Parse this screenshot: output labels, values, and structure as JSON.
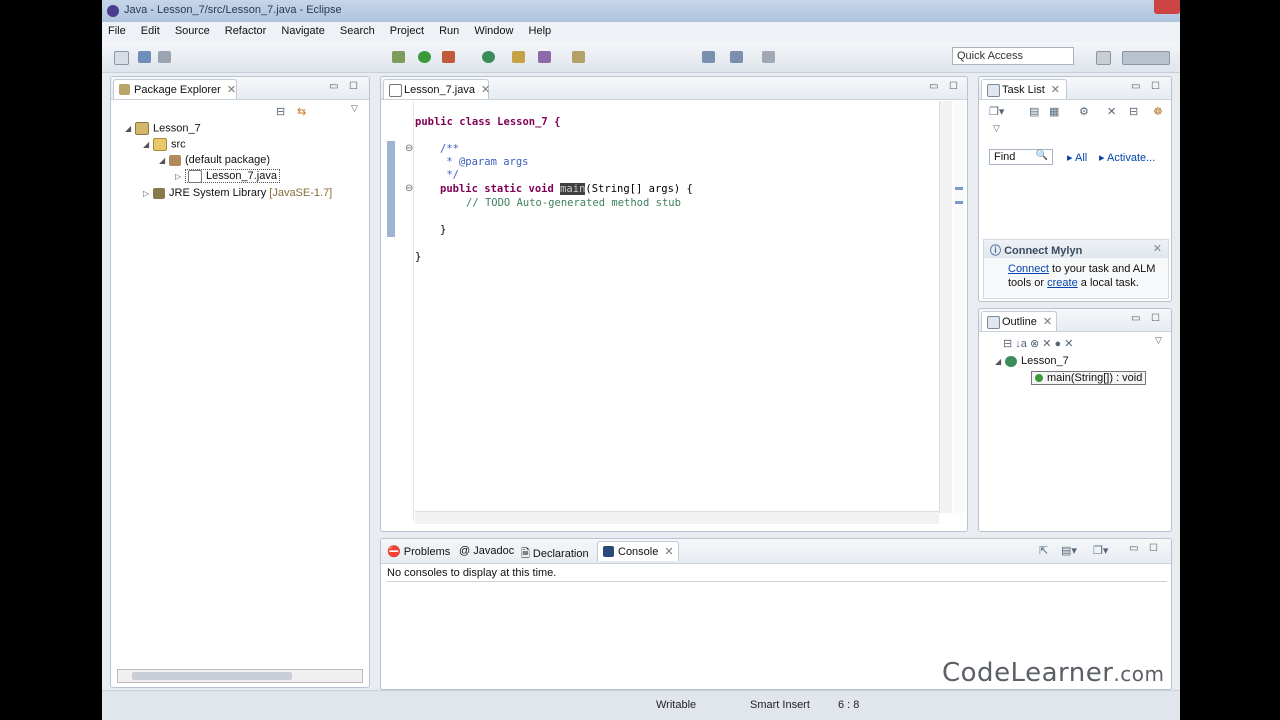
{
  "window": {
    "title": "Java - Lesson_7/src/Lesson_7.java - Eclipse"
  },
  "menu": [
    "File",
    "Edit",
    "Source",
    "Refactor",
    "Navigate",
    "Search",
    "Project",
    "Run",
    "Window",
    "Help"
  ],
  "toolbar": {
    "quick_access_placeholder": "Quick Access"
  },
  "package_explorer": {
    "tab": "Package Explorer",
    "tree": {
      "project": "Lesson_7",
      "src": "src",
      "package": "(default package)",
      "file": "Lesson_7.java",
      "jre": "JRE System Library",
      "jre_version": "[JavaSE-1.7]"
    }
  },
  "editor": {
    "tab": "Lesson_7.java",
    "lines": {
      "l1": "public class Lesson_7 {",
      "l2": "/**",
      "l3": " * @param args",
      "l4": " */",
      "l5_kw": "public static void ",
      "l5_sel": "main",
      "l5_rest": "(String[] args) {",
      "l6": "// TODO Auto-generated method stub",
      "l7": "}",
      "l8": "}"
    }
  },
  "task_list": {
    "tab": "Task List",
    "find_placeholder": "Find",
    "all": "All",
    "activate": "Activate..."
  },
  "mylyn": {
    "title": "Connect Mylyn",
    "connect": "Connect",
    "text1": " to your task and ALM",
    "text2a": "tools or ",
    "create": "create",
    "text2b": " a local task."
  },
  "outline": {
    "tab": "Outline",
    "class": "Lesson_7",
    "method": "main(String[]) : void"
  },
  "bottom": {
    "tabs": [
      "Problems",
      "Javadoc",
      "Declaration",
      "Console"
    ],
    "console_message": "No consoles to display at this time."
  },
  "status": {
    "writable": "Writable",
    "insert": "Smart Insert",
    "pos": "6 : 8"
  },
  "watermark": {
    "main": "CodeLearner",
    "suffix": ".com"
  },
  "colors": {
    "keyword": "#7f0055",
    "comment": "#3f7f5f",
    "javadoc": "#3f5fbf",
    "selection": "#404040"
  }
}
